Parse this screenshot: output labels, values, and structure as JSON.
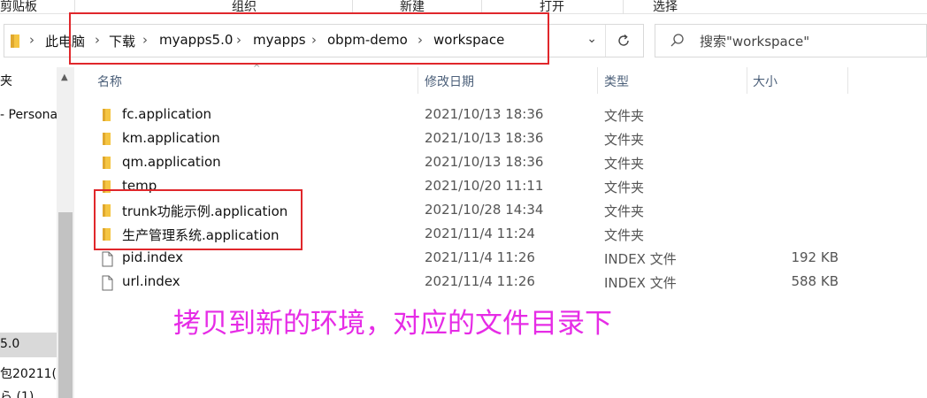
{
  "ribbon": {
    "groups": [
      "剪贴板",
      "组织",
      "新建",
      "打开",
      "选择"
    ]
  },
  "address_bar": {
    "breadcrumbs": [
      "此电脑",
      "下载",
      "myapps5.0",
      "myapps",
      "obpm-demo",
      "workspace"
    ],
    "chevron": "›",
    "dropdown": "⌄",
    "refresh_icon": "refresh-icon"
  },
  "search": {
    "placeholder": "搜索\"workspace\""
  },
  "nav_pane": {
    "items": [
      "夹",
      "- Persona",
      "5.0",
      "包20211(",
      "ら (1)"
    ]
  },
  "columns": {
    "name": "名称",
    "modified": "修改日期",
    "type": "类型",
    "size": "大小"
  },
  "files": [
    {
      "name": "fc.application",
      "modified": "2021/10/13 18:36",
      "type": "文件夹",
      "size": "",
      "icon": "folder-icon"
    },
    {
      "name": "km.application",
      "modified": "2021/10/13 18:36",
      "type": "文件夹",
      "size": "",
      "icon": "folder-icon"
    },
    {
      "name": "qm.application",
      "modified": "2021/10/13 18:36",
      "type": "文件夹",
      "size": "",
      "icon": "folder-icon"
    },
    {
      "name": "temp",
      "modified": "2021/10/20 11:11",
      "type": "文件夹",
      "size": "",
      "icon": "folder-icon"
    },
    {
      "name": "trunk功能示例.application",
      "modified": "2021/10/28 14:34",
      "type": "文件夹",
      "size": "",
      "icon": "folder-icon"
    },
    {
      "name": "生产管理系统.application",
      "modified": "2021/11/4 11:24",
      "type": "文件夹",
      "size": "",
      "icon": "folder-icon"
    },
    {
      "name": "pid.index",
      "modified": "2021/11/4 11:26",
      "type": "INDEX 文件",
      "size": "192 KB",
      "icon": "file-icon"
    },
    {
      "name": "url.index",
      "modified": "2021/11/4 11:26",
      "type": "INDEX 文件",
      "size": "588 KB",
      "icon": "file-icon"
    }
  ],
  "annotation": "拷贝到新的环境，对应的文件目录下",
  "colors": {
    "highlight_box": "#e0272b",
    "annotation_text": "#e62ce6",
    "folder": "#f5c542",
    "header_text": "#4c607a"
  }
}
